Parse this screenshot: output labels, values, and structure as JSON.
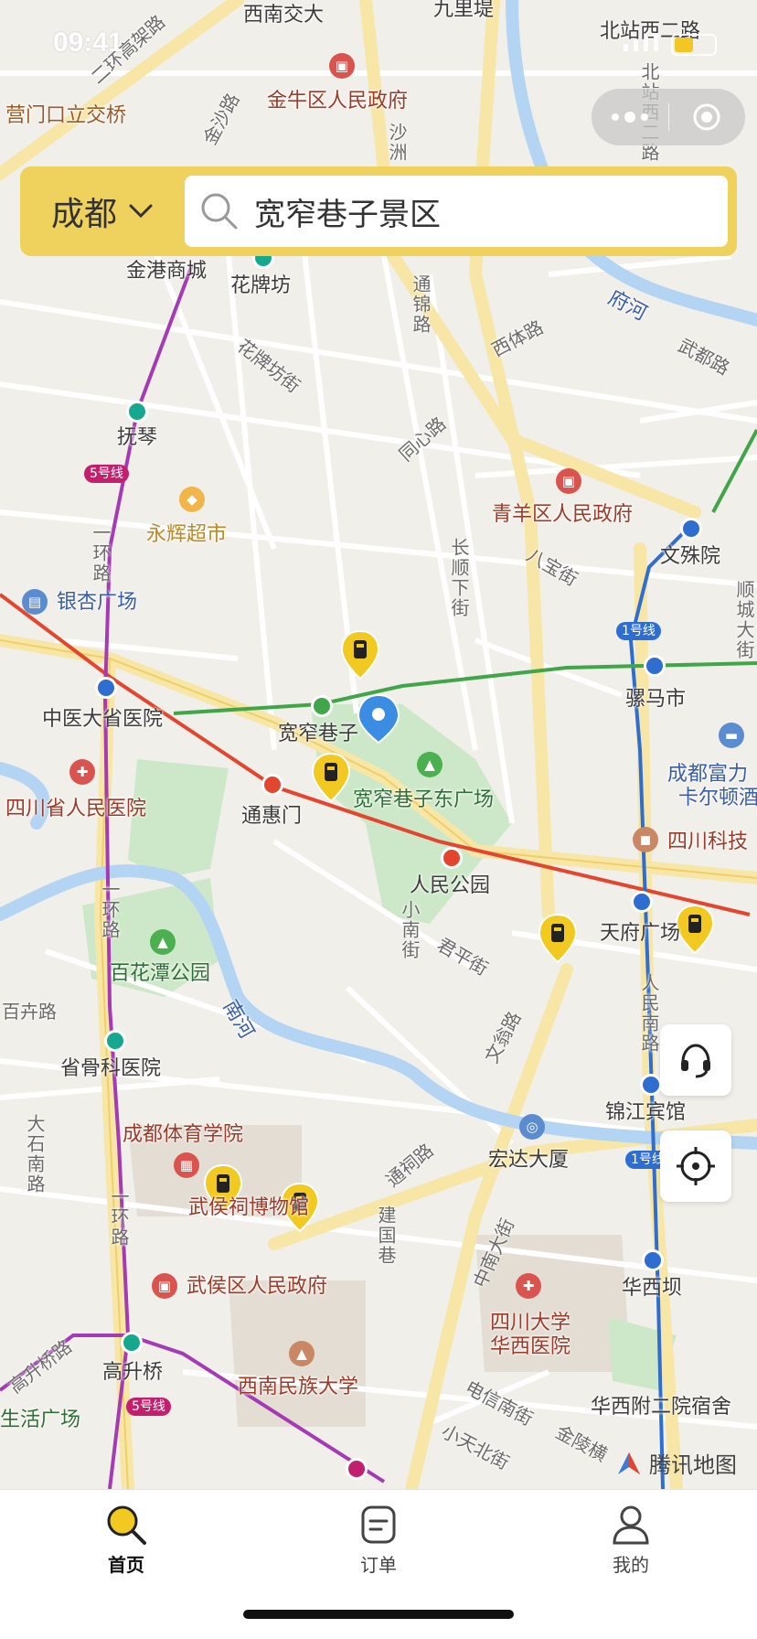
{
  "status_bar": {
    "time": "09:41"
  },
  "search": {
    "city": "成都",
    "query": "宽窄巷子景区"
  },
  "map": {
    "labels": {
      "xinan_jiaoda": "西南交大",
      "jiulidi": "九里堤",
      "beizhanxi2": "北站西二路",
      "beizhanxi2_v": "北站西二路",
      "yingmenkou": "营门口立交桥",
      "jinniu_gov": "金牛区人民政府",
      "er_huan": "二环高架路",
      "jingang": "金港商城",
      "huapaifang": "花牌坊",
      "tongjin": "通锦路",
      "xiti": "西体路",
      "fuhe": "府河",
      "wudu": "武都路",
      "huapaifang_st": "花牌坊街",
      "fuqin": "抚琴",
      "line5": "5号线",
      "tongxin": "同心路",
      "qingyang_gov": "青羊区人民政府",
      "wenshuyuan": "文殊院",
      "yonghui": "永辉超市",
      "yihuan_v": "一环路",
      "changshun": "长顺下街",
      "babao": "八宝街",
      "yinxing": "银杏广场",
      "line1": "1号线",
      "shuncheng": "顺城大街",
      "zhongyi": "中医大省医院",
      "kuanzhai": "宽窄巷子",
      "luomashi": "骡马市",
      "kuanzhai_east": "宽窄巷子东广场",
      "tonghuimen": "通惠门",
      "fuli": "成都富力",
      "kaerdun": "卡尔顿酒",
      "renmin_hosp": "四川省人民医院",
      "sc_keji": "四川科技",
      "renmin_park": "人民公园",
      "xiaonan": "小南街",
      "junping": "君平街",
      "tianfu": "天府广场",
      "baihuatan": "百花潭公园",
      "yihuan_v2": "一环路",
      "baihua_rd": "百卉路",
      "nanhe": "南河",
      "wenweng": "文翁路",
      "renminnan": "人民南路",
      "gugu": "省骨科医院",
      "jinjiang_hotel": "锦江宾馆",
      "tiyu": "成都体育学院",
      "hongda": "宏达大厦",
      "dashi": "大石南路",
      "tongci": "通祠路",
      "wuhouci": "武侯祠博物馆",
      "yihuan_v3": "一环路",
      "jianguo": "建国巷",
      "zhongnan": "中南大街",
      "huaxiba": "华西坝",
      "wuhou_gov": "武侯区人民政府",
      "huaxi_hosp": "四川大学华西医院",
      "gaosheng": "高升桥",
      "minzu": "西南民族大学",
      "huaxi2": "华西附二院宿舍",
      "shenghuo": "生活广场",
      "dianxin": "电信南街",
      "jinling": "金陵横",
      "xiaotian": "小天北街",
      "gaosheng_rd": "高升桥路",
      "line5b": "5号线",
      "line1b": "1号线",
      "jinniu_ba": "金沙路",
      "shazhou": "沙洲"
    },
    "attribution": "腾讯地图",
    "colors": {
      "line5": "#a43bb5",
      "line1": "#2e6ed1",
      "line4": "#41a64a",
      "line2": "#e2462e",
      "locker": "#f2c920",
      "accent": "#efd25d"
    }
  },
  "floating_buttons": {
    "support": "headset-icon",
    "locate": "crosshair-icon"
  },
  "tabbar": {
    "items": [
      {
        "label": "首页"
      },
      {
        "label": "订单"
      },
      {
        "label": "我的"
      }
    ]
  }
}
